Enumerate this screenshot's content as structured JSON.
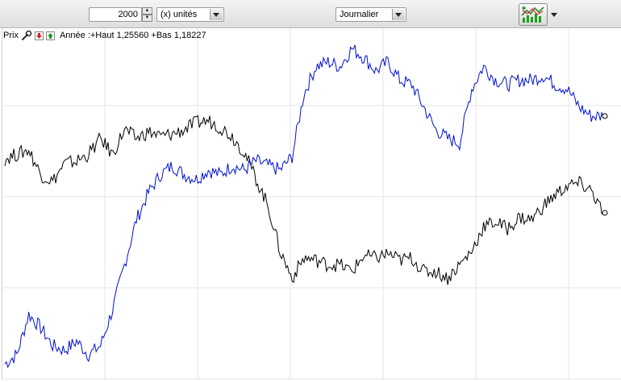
{
  "toolbar": {
    "units_value": "2000",
    "units_label": "(x) unités",
    "period_label": "Journalier",
    "icons": {
      "spin": "spinner-icon",
      "chart": "indicator-chart-icon",
      "drop": "chevron-down-icon"
    }
  },
  "legend": {
    "prefix": "Prix",
    "summary": "Année :+Haut 1,25560 +Bas 1,18227",
    "icons": [
      "wrench-icon",
      "arrow-down-icon",
      "arrow-up-icon"
    ]
  },
  "colors": {
    "series_primary": "#0010d0",
    "series_secondary": "#000000",
    "grid": "#e6e6e6"
  },
  "chart_data": {
    "type": "line",
    "grid": true,
    "series": [
      {
        "color": "#0010d0",
        "values": [
          1.184,
          1.186,
          1.195,
          1.192,
          1.188,
          1.187,
          1.189,
          1.186,
          1.188,
          1.196,
          1.206,
          1.216,
          1.222,
          1.226,
          1.228,
          1.226,
          1.225,
          1.227,
          1.226,
          1.228,
          1.227,
          1.229,
          1.228,
          1.227,
          1.23,
          1.244,
          1.25,
          1.251,
          1.25,
          1.254,
          1.252,
          1.249,
          1.251,
          1.247,
          1.246,
          1.241,
          1.236,
          1.234,
          1.233,
          1.245,
          1.25,
          1.247,
          1.246,
          1.247,
          1.247,
          1.248,
          1.246,
          1.245,
          1.241,
          1.239,
          1.239
        ]
      },
      {
        "color": "#000000",
        "values": [
          1.2295,
          1.2305,
          1.2315,
          1.226,
          1.2245,
          1.2285,
          1.229,
          1.2305,
          1.234,
          1.2305,
          1.236,
          1.234,
          1.2355,
          1.2345,
          1.235,
          1.236,
          1.2375,
          1.238,
          1.2365,
          1.2345,
          1.231,
          1.225,
          1.219,
          1.209,
          1.203,
          1.2075,
          1.207,
          1.206,
          1.206,
          1.2045,
          1.208,
          1.2075,
          1.2085,
          1.207,
          1.2075,
          1.2045,
          1.2045,
          1.203,
          1.206,
          1.209,
          1.2145,
          1.2155,
          1.214,
          1.2165,
          1.216,
          1.219,
          1.2215,
          1.2235,
          1.224,
          1.2225,
          1.2175
        ]
      }
    ],
    "ylim": [
      1.1805,
      1.2585
    ],
    "end_markers": true
  }
}
